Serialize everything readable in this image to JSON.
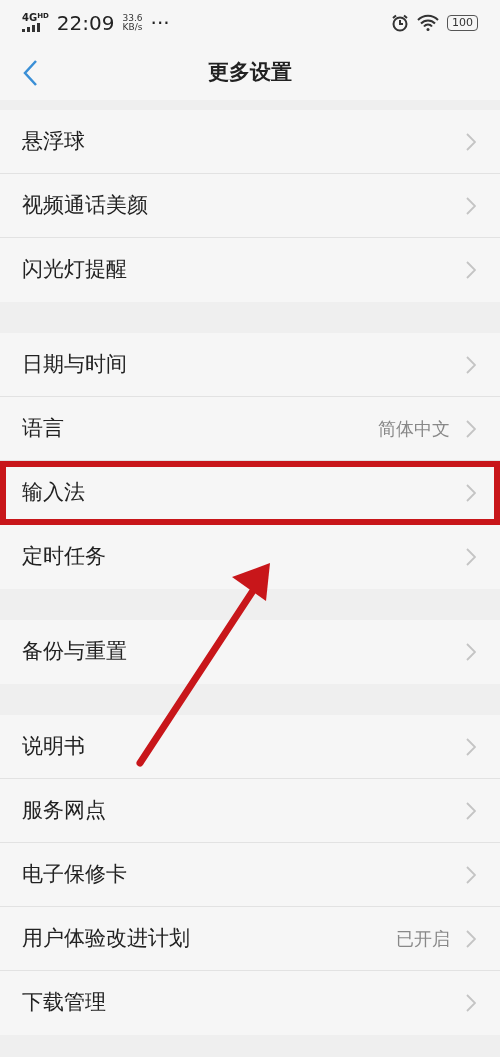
{
  "status_bar": {
    "network": "4G",
    "network_badge": "HD",
    "time": "22:09",
    "speed": "33.6",
    "speed_unit": "KB/s",
    "more": "···",
    "battery": "100"
  },
  "header": {
    "title": "更多设置"
  },
  "groups": [
    {
      "items": [
        {
          "label": "悬浮球",
          "highlighted": false
        },
        {
          "label": "视频通话美颜",
          "highlighted": false
        },
        {
          "label": "闪光灯提醒",
          "highlighted": false
        }
      ]
    },
    {
      "items": [
        {
          "label": "日期与时间",
          "highlighted": false
        },
        {
          "label": "语言",
          "value": "简体中文",
          "highlighted": false
        },
        {
          "label": "输入法",
          "highlighted": true
        },
        {
          "label": "定时任务",
          "highlighted": false
        }
      ]
    },
    {
      "items": [
        {
          "label": "备份与重置",
          "highlighted": false
        }
      ]
    },
    {
      "items": [
        {
          "label": "说明书",
          "highlighted": false
        },
        {
          "label": "服务网点",
          "highlighted": false
        },
        {
          "label": "电子保修卡",
          "highlighted": false
        },
        {
          "label": "用户体验改进计划",
          "value": "已开启",
          "highlighted": false
        },
        {
          "label": "下载管理",
          "highlighted": false
        }
      ]
    }
  ]
}
